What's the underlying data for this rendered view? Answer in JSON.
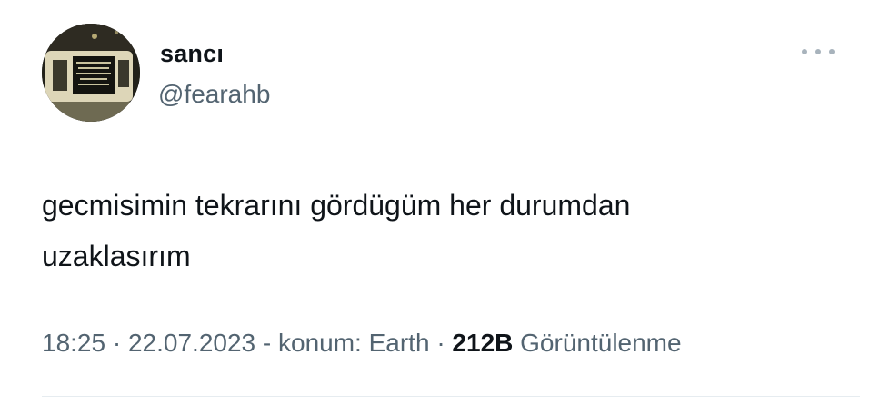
{
  "tweet": {
    "display_name": "sancı",
    "handle": "@fearahb",
    "text_lines": [
      "gecmisimin tekrarını gördügüm her durumdan",
      "uzaklasırım"
    ],
    "time": "18:25",
    "date": "22.07.2023",
    "location": "- konum: Earth",
    "separator": "·",
    "views_count": "212B",
    "views_label": "Görüntülenme"
  },
  "icons": {
    "more": "more-horizontal-icon",
    "avatar": "user-avatar"
  },
  "colors": {
    "text_primary": "#0f1419",
    "text_secondary": "#536471",
    "divider": "#e6ecf0"
  }
}
